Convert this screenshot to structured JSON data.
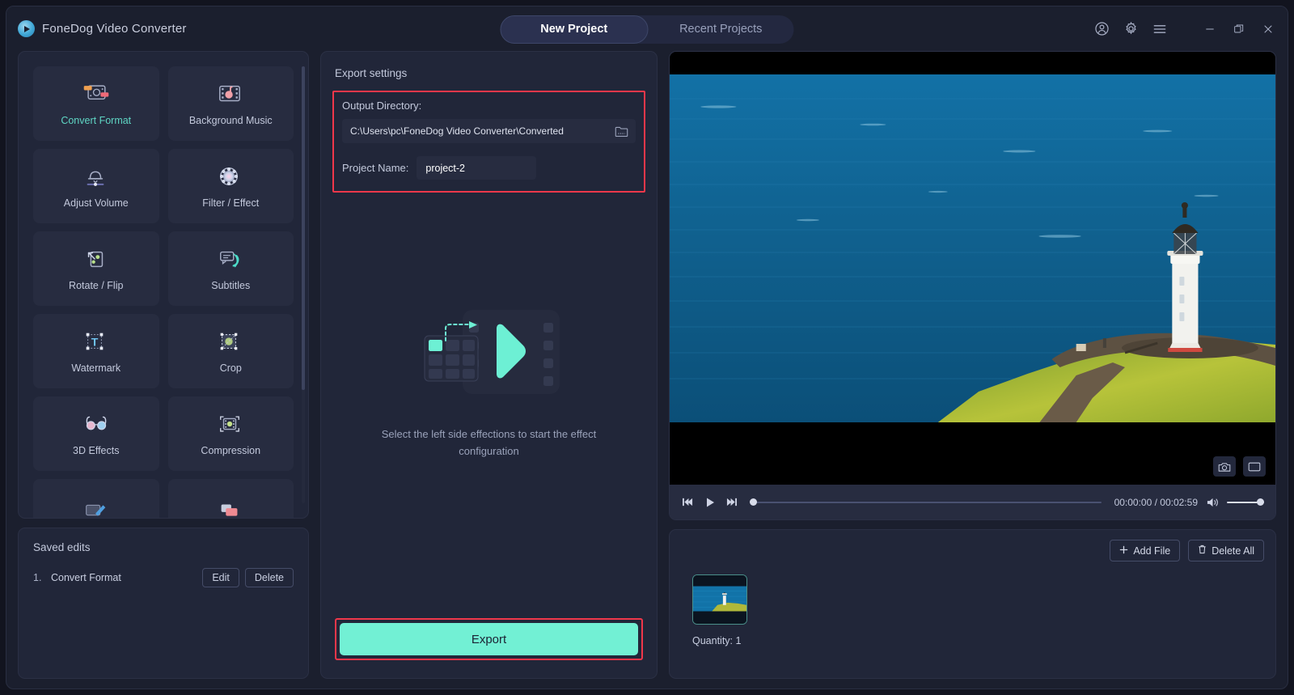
{
  "app": {
    "brand": "FoneDog Video Converter",
    "logo_icon": "play-circle-icon"
  },
  "titlebar": {
    "tabs": [
      {
        "label": "New Project",
        "active": true
      },
      {
        "label": "Recent Projects",
        "active": false
      }
    ],
    "icons": [
      {
        "name": "account-icon",
        "glyph": "account"
      },
      {
        "name": "settings-gear-icon",
        "glyph": "gear"
      },
      {
        "name": "menu-hamburger-icon",
        "glyph": "menu"
      },
      {
        "name": "minimize-icon",
        "glyph": "minimize"
      },
      {
        "name": "maximize-icon",
        "glyph": "maximize"
      },
      {
        "name": "close-icon",
        "glyph": "close"
      }
    ]
  },
  "sidebar": {
    "tools": [
      {
        "label": "Convert Format",
        "icon": "convert-format-icon",
        "selected": true
      },
      {
        "label": "Background Music",
        "icon": "background-music-icon",
        "selected": false
      },
      {
        "label": "Adjust Volume",
        "icon": "adjust-volume-icon",
        "selected": false
      },
      {
        "label": "Filter / Effect",
        "icon": "filter-effect-icon",
        "selected": false
      },
      {
        "label": "Rotate / Flip",
        "icon": "rotate-flip-icon",
        "selected": false
      },
      {
        "label": "Subtitles",
        "icon": "subtitles-icon",
        "selected": false
      },
      {
        "label": "Watermark",
        "icon": "watermark-icon",
        "selected": false
      },
      {
        "label": "Crop",
        "icon": "crop-icon",
        "selected": false
      },
      {
        "label": "3D Effects",
        "icon": "3d-effects-icon",
        "selected": false
      },
      {
        "label": "Compression",
        "icon": "compression-icon",
        "selected": false
      },
      {
        "label": "",
        "icon": "enhance-icon",
        "selected": false
      },
      {
        "label": "",
        "icon": "merge-icon",
        "selected": false
      }
    ],
    "selected_label_color": "#5fd6c4"
  },
  "saved_edits": {
    "title": "Saved edits",
    "rows": [
      {
        "index": "1.",
        "name": "Convert Format",
        "edit_label": "Edit",
        "delete_label": "Delete"
      }
    ]
  },
  "export_settings": {
    "title": "Export settings",
    "output_directory_label": "Output Directory:",
    "output_directory_value": "C:\\Users\\pc\\FoneDog Video Converter\\Converted",
    "folder_browse_icon": "folder-browse-icon",
    "project_name_label": "Project Name:",
    "project_name_value": "project-2",
    "highlight_color": "#f0374a"
  },
  "placeholder": {
    "text": "Select the left side effections to start the effect configuration",
    "icon": "effects-placeholder-icon",
    "accent": "#72f0d4"
  },
  "export": {
    "label": "Export",
    "button_color": "#72f0d4",
    "highlight_color": "#f0374a"
  },
  "preview": {
    "snapshot_icon": "camera-snapshot-icon",
    "fullscreen_icon": "fullscreen-icon",
    "controls": {
      "prev_icon": "skip-previous-icon",
      "play_icon": "play-icon",
      "next_icon": "skip-next-icon",
      "current_time": "00:00:00",
      "total_time": "00:02:59",
      "time_display": "00:00:00 / 00:02:59",
      "volume_icon": "volume-icon",
      "progress_percent": 0,
      "volume_percent": 100
    }
  },
  "files": {
    "add_file_label": "Add File",
    "add_file_icon": "plus-icon",
    "delete_all_label": "Delete All",
    "delete_all_icon": "trash-icon",
    "quantity_label": "Quantity: 1",
    "thumbnail_name": "lighthouse-thumbnail"
  }
}
